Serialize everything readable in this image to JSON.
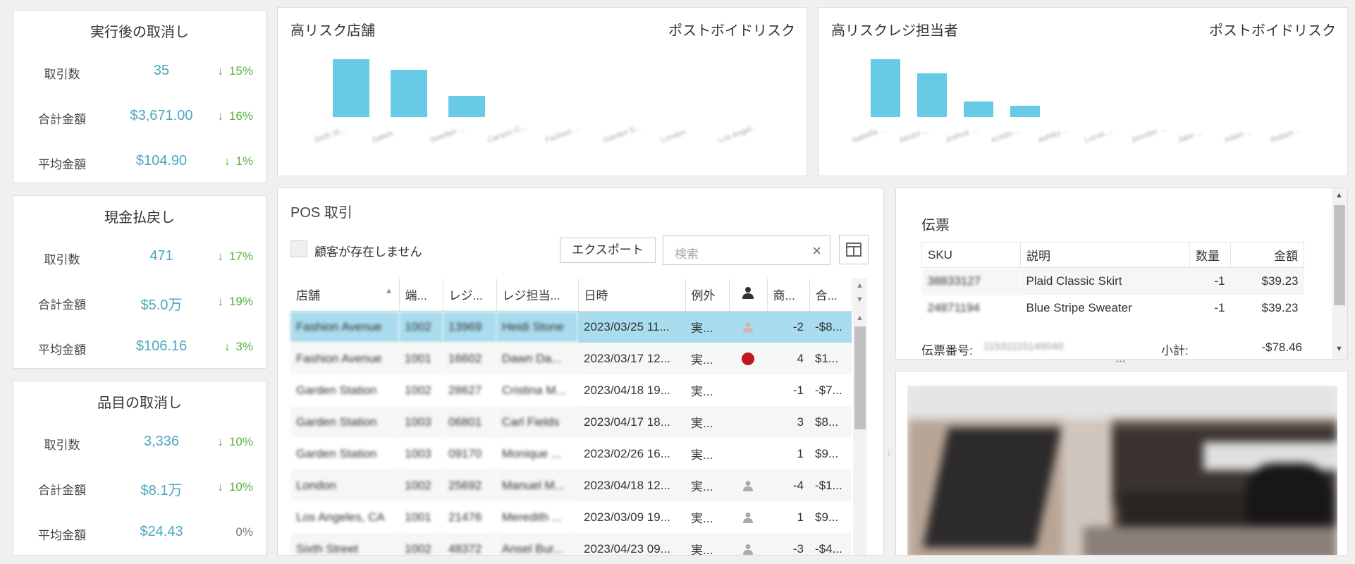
{
  "kpis": [
    {
      "title": "実行後の取消し",
      "rows": [
        {
          "label": "取引数",
          "value": "35",
          "pct": "15%",
          "dir": "down"
        },
        {
          "label": "合計金額",
          "value": "$3,671.00",
          "pct": "16%",
          "dir": "down"
        },
        {
          "label": "平均金額",
          "value": "$104.90",
          "pct": "1%",
          "dir": "down"
        }
      ]
    },
    {
      "title": "現金払戻し",
      "rows": [
        {
          "label": "取引数",
          "value": "471",
          "pct": "17%",
          "dir": "down"
        },
        {
          "label": "合計金額",
          "value": "$5.0万",
          "pct": "19%",
          "dir": "down"
        },
        {
          "label": "平均金額",
          "value": "$106.16",
          "pct": "3%",
          "dir": "down"
        }
      ]
    },
    {
      "title": "品目の取消し",
      "rows": [
        {
          "label": "取引数",
          "value": "3,336",
          "pct": "10%",
          "dir": "down"
        },
        {
          "label": "合計金額",
          "value": "$8.1万",
          "pct": "10%",
          "dir": "down"
        },
        {
          "label": "平均金額",
          "value": "$24.43",
          "pct": "0%",
          "dir": "flat"
        }
      ]
    }
  ],
  "chart_data": [
    {
      "type": "bar",
      "title": "高リスク店舗",
      "subtitle": "ポストボイドリスク",
      "categories": [
        "Sixth St...",
        "Salem",
        "Sweden ...",
        "Canyon C...",
        "Fashion ...",
        "Garden S...",
        "London",
        "Los Angel..."
      ],
      "values": [
        100,
        82,
        36,
        0,
        0,
        0,
        0,
        0
      ],
      "ylim": [
        0,
        100
      ]
    },
    {
      "type": "bar",
      "title": "高リスクレジ担当者",
      "subtitle": "ポストボイドリスク",
      "categories": [
        "Isabella ...",
        "Jacqui ...",
        "Joshua ...",
        "Kristin ...",
        "Ashley ...",
        "Lucas ...",
        "Jennifer ...",
        "Jake ...",
        "Adam ...",
        "Robert ..."
      ],
      "values": [
        100,
        76,
        27,
        20,
        0,
        0,
        0,
        0,
        0,
        0
      ],
      "ylim": [
        0,
        100
      ]
    }
  ],
  "pos": {
    "title": "POS 取引",
    "checkbox_label": "顧客が存在しません",
    "export_label": "エクスポート",
    "search_placeholder": "検索",
    "clear_symbol": "×",
    "columns": [
      "店舗",
      "端...",
      "レジ...",
      "レジ担当...",
      "日時",
      "例外",
      "",
      "商...",
      "合..."
    ],
    "rows": [
      {
        "store": "Fashion Avenue",
        "term": "1002",
        "reg": "13969",
        "cashier": "Heidi Stone",
        "date": "2023/03/25 11...",
        "ex": "実...",
        "cust": "person-faint",
        "qty": "-2",
        "total": "-$8..."
      },
      {
        "store": "Fashion Avenue",
        "term": "1001",
        "reg": "16602",
        "cashier": "Dawn Da...",
        "date": "2023/03/17 12...",
        "ex": "実...",
        "cust": "red-dot",
        "qty": "4",
        "total": "$1..."
      },
      {
        "store": "Garden Station",
        "term": "1002",
        "reg": "28627",
        "cashier": "Cristina M...",
        "date": "2023/04/18 19...",
        "ex": "実...",
        "cust": "",
        "qty": "-1",
        "total": "-$7..."
      },
      {
        "store": "Garden Station",
        "term": "1003",
        "reg": "06801",
        "cashier": "Carl Fields",
        "date": "2023/04/17 18...",
        "ex": "実...",
        "cust": "",
        "qty": "3",
        "total": "$8..."
      },
      {
        "store": "Garden Station",
        "term": "1003",
        "reg": "09170",
        "cashier": "Monique ...",
        "date": "2023/02/26 16...",
        "ex": "実...",
        "cust": "",
        "qty": "1",
        "total": "$9..."
      },
      {
        "store": "London",
        "term": "1002",
        "reg": "25692",
        "cashier": "Manuel M...",
        "date": "2023/04/18 12...",
        "ex": "実...",
        "cust": "person",
        "qty": "-4",
        "total": "-$1..."
      },
      {
        "store": "Los Angeles, CA",
        "term": "1001",
        "reg": "21476",
        "cashier": "Meredith ...",
        "date": "2023/03/09 19...",
        "ex": "実...",
        "cust": "person",
        "qty": "1",
        "total": "$9..."
      },
      {
        "store": "Sixth Street",
        "term": "1002",
        "reg": "48372",
        "cashier": "Ansel Bur...",
        "date": "2023/04/23 09...",
        "ex": "実...",
        "cust": "person",
        "qty": "-3",
        "total": "-$4..."
      }
    ]
  },
  "slip": {
    "title": "伝票",
    "columns": [
      "SKU",
      "説明",
      "数量",
      "金額"
    ],
    "rows": [
      {
        "sku": "38833127",
        "desc": "Plaid Classic Skirt",
        "qty": "-1",
        "amt": "$39.23"
      },
      {
        "sku": "24871194",
        "desc": "Blue Stripe Sweater",
        "qty": "-1",
        "amt": "$39.23"
      }
    ],
    "number_label": "伝票番号:",
    "number_value": "11531115146040",
    "subtotal_label": "小計:",
    "subtotal_value": "-$78.46"
  },
  "splitter_dots": "•••",
  "colors": {
    "accent": "#4aa8c0",
    "bar": "#67cbe8",
    "down": "#5ab03c",
    "selected": "#a9dced",
    "red": "#c0171d"
  }
}
